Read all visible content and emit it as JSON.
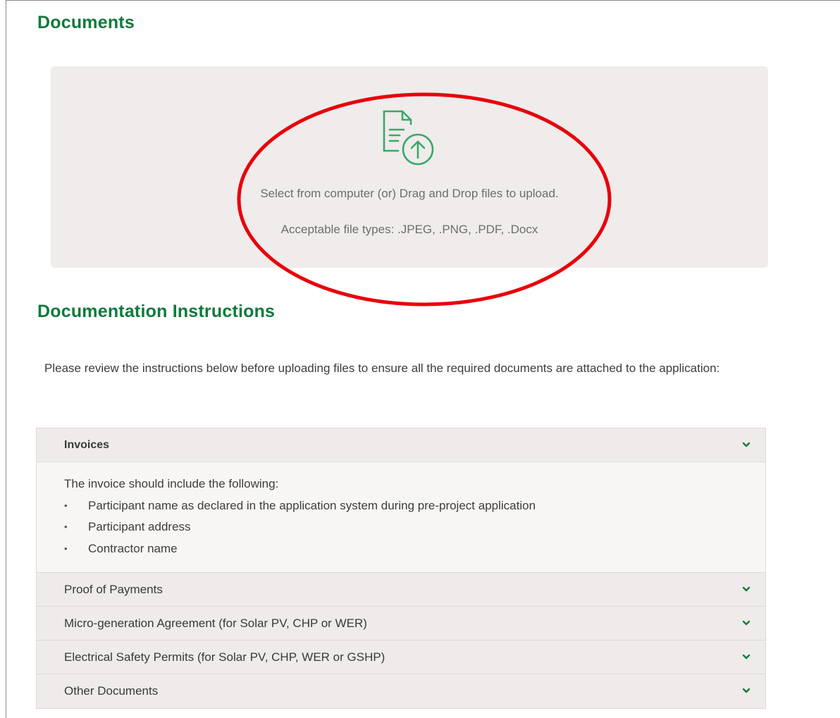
{
  "documents": {
    "title": "Documents",
    "upload": {
      "icon": "file-upload-icon",
      "instruction": "Select from computer (or) Drag and Drop files to upload.",
      "accepted": "Acceptable file types: .JPEG, .PNG, .PDF, .Docx"
    }
  },
  "instructions": {
    "title": "Documentation Instructions",
    "intro": "Please review the instructions below before uploading files to ensure all the required documents are attached to the application:"
  },
  "accordion": {
    "items": [
      {
        "label": "Invoices",
        "expanded": true,
        "body": {
          "lead": "The invoice should include the following:",
          "bullets": [
            "Participant name as declared in the application system during pre-project application",
            "Participant address",
            "Contractor name"
          ]
        }
      },
      {
        "label": "Proof of Payments",
        "expanded": false
      },
      {
        "label": "Micro-generation Agreement (for Solar PV, CHP or WER)",
        "expanded": false
      },
      {
        "label": "Electrical Safety Permits (for Solar PV, CHP, WER or GSHP)",
        "expanded": false
      },
      {
        "label": "Other Documents",
        "expanded": false
      }
    ]
  },
  "colors": {
    "brand_green": "#0f7a3c",
    "annotation_red": "#e8000b",
    "panel_bg": "#efeceb"
  }
}
